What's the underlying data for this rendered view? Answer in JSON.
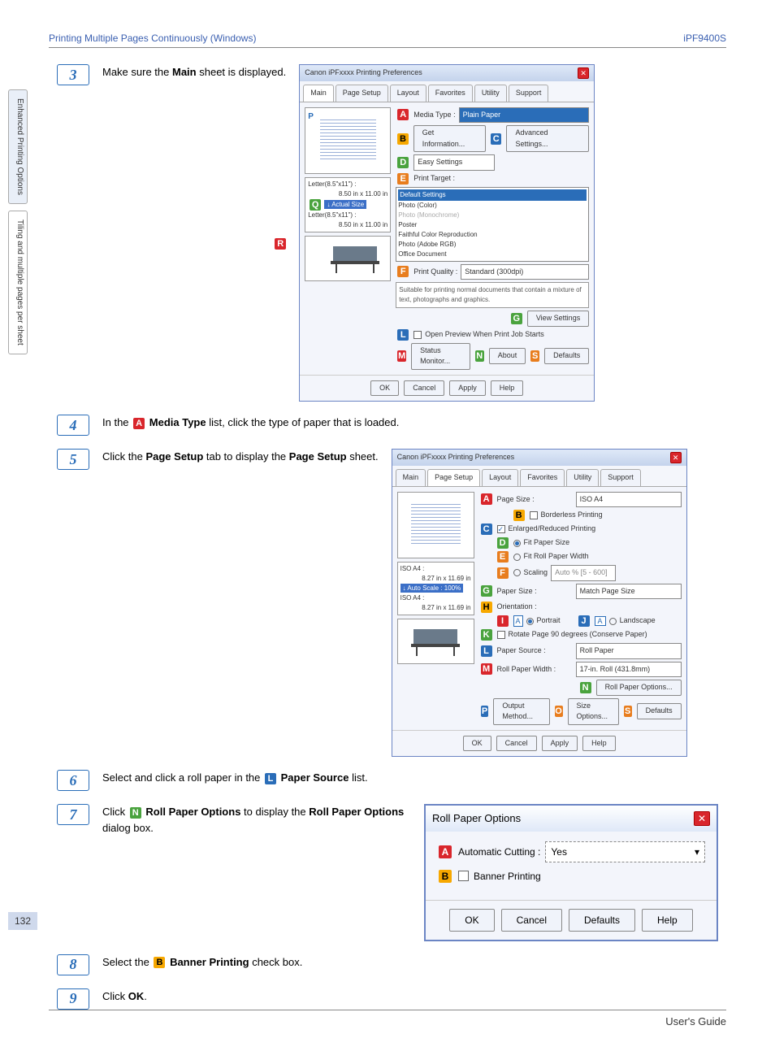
{
  "header": {
    "section": "Printing Multiple Pages Continuously (Windows)",
    "model": "iPF9400S"
  },
  "sidebar": {
    "tab1": "Enhanced Printing Options",
    "tab2": "Tiling and multiple pages per sheet"
  },
  "steps": {
    "s3": {
      "num": "3",
      "text_a": "Make sure the ",
      "bold_a": "Main",
      "text_b": " sheet is displayed."
    },
    "s4": {
      "num": "4",
      "text_a": "In the ",
      "badge": "A",
      "bold_a": "Media Type",
      "text_b": " list, click the type of paper that is loaded."
    },
    "s5": {
      "num": "5",
      "text_a": "Click the ",
      "bold_a": "Page Setup",
      "text_b": " tab to display the ",
      "bold_b": "Page Setup",
      "text_c": " sheet."
    },
    "s6": {
      "num": "6",
      "text_a": "Select and click a roll paper in the ",
      "badge": "L",
      "bold_a": "Paper Source",
      "text_b": " list."
    },
    "s7": {
      "num": "7",
      "text_a": "Click ",
      "badge": "N",
      "bold_a": "Roll Paper Options",
      "text_b": " to display the ",
      "bold_b": "Roll Paper Options",
      "text_c": " dialog box."
    },
    "s8": {
      "num": "8",
      "text_a": "Select the ",
      "badge": "B",
      "bold_a": "Banner Printing",
      "text_b": " check box."
    },
    "s9": {
      "num": "9",
      "text_a": "Click ",
      "bold_a": "OK",
      "text_b": "."
    }
  },
  "fig1": {
    "title": "Canon iPFxxxx Printing Preferences",
    "tabs": [
      "Main",
      "Page Setup",
      "Layout",
      "Favorites",
      "Utility",
      "Support"
    ],
    "media_type_label": "Media Type :",
    "media_type_value": "Plain Paper",
    "get_info": "Get Information...",
    "adv_settings": "Advanced Settings...",
    "easy": "Easy Settings",
    "print_target": "Print Target :",
    "targets": [
      "Default Settings",
      "Photo (Color)",
      "Photo (Monochrome)",
      "Poster",
      "Faithful Color Reproduction",
      "Photo (Adobe RGB)",
      "Office Document"
    ],
    "print_quality_label": "Print Quality :",
    "print_quality_value": "Standard (300dpi)",
    "desc": "Suitable for printing normal documents that contain a mixture of text, photographs and graphics.",
    "view_settings": "View Settings",
    "open_preview": "Open Preview When Print Job Starts",
    "status_monitor": "Status Monitor...",
    "about": "About",
    "defaults": "Defaults",
    "ok": "OK",
    "cancel": "Cancel",
    "apply": "Apply",
    "help": "Help",
    "left_size1_a": "Letter(8.5\"x11\") :",
    "left_size1_b": "8.50 in x 11.00 in",
    "left_actual": "Actual Size",
    "left_size2_a": "Letter(8.5\"x11\") :",
    "left_size2_b": "8.50 in x 11.00 in",
    "badges": {
      "A": "A",
      "B": "B",
      "C": "C",
      "D": "D",
      "E": "E",
      "F": "F",
      "G": "G",
      "L": "L",
      "M": "M",
      "N": "N",
      "P": "P",
      "Q": "Q",
      "R": "R",
      "S": "S"
    }
  },
  "fig2": {
    "title": "Canon iPFxxxx Printing Preferences",
    "tabs": [
      "Main",
      "Page Setup",
      "Layout",
      "Favorites",
      "Utility",
      "Support"
    ],
    "page_size_label": "Page Size :",
    "page_size_value": "ISO A4",
    "borderless": "Borderless Printing",
    "enlarge": "Enlarged/Reduced Printing",
    "fit_paper": "Fit Paper Size",
    "fit_roll": "Fit Roll Paper Width",
    "scaling": "Scaling",
    "scaling_hint": "Auto    %  [5 - 600]",
    "paper_size_label": "Paper Size :",
    "paper_size_value": "Match Page Size",
    "orientation": "Orientation :",
    "portrait": "Portrait",
    "landscape": "Landscape",
    "rotate": "Rotate Page 90 degrees (Conserve Paper)",
    "paper_source_label": "Paper Source :",
    "paper_source_value": "Roll Paper",
    "roll_width_label": "Roll Paper Width :",
    "roll_width_value": "17-in. Roll (431.8mm)",
    "roll_options": "Roll Paper Options...",
    "output_method": "Output Method...",
    "size_options": "Size Options...",
    "defaults": "Defaults",
    "ok": "OK",
    "cancel": "Cancel",
    "apply": "Apply",
    "help": "Help",
    "left_size1_a": "ISO A4 :",
    "left_size1_b": "8.27 in x 11.69 in",
    "left_auto": "Auto Scale : 100%",
    "left_size2_a": "ISO A4 :",
    "left_size2_b": "8.27 in x 11.69 in",
    "badges": {
      "A": "A",
      "B": "B",
      "C": "C",
      "D": "D",
      "E": "E",
      "F": "F",
      "G": "G",
      "H": "H",
      "I": "I",
      "J": "J",
      "K": "K",
      "L": "L",
      "M": "M",
      "N": "N",
      "O": "O",
      "P": "P",
      "S": "S"
    }
  },
  "roll": {
    "title": "Roll Paper Options",
    "auto_cut_label": "Automatic Cutting :",
    "auto_cut_value": "Yes",
    "banner": "Banner Printing",
    "ok": "OK",
    "cancel": "Cancel",
    "defaults": "Defaults",
    "help": "Help",
    "badges": {
      "A": "A",
      "B": "B"
    }
  },
  "page_number": "132",
  "footer": "User's Guide"
}
